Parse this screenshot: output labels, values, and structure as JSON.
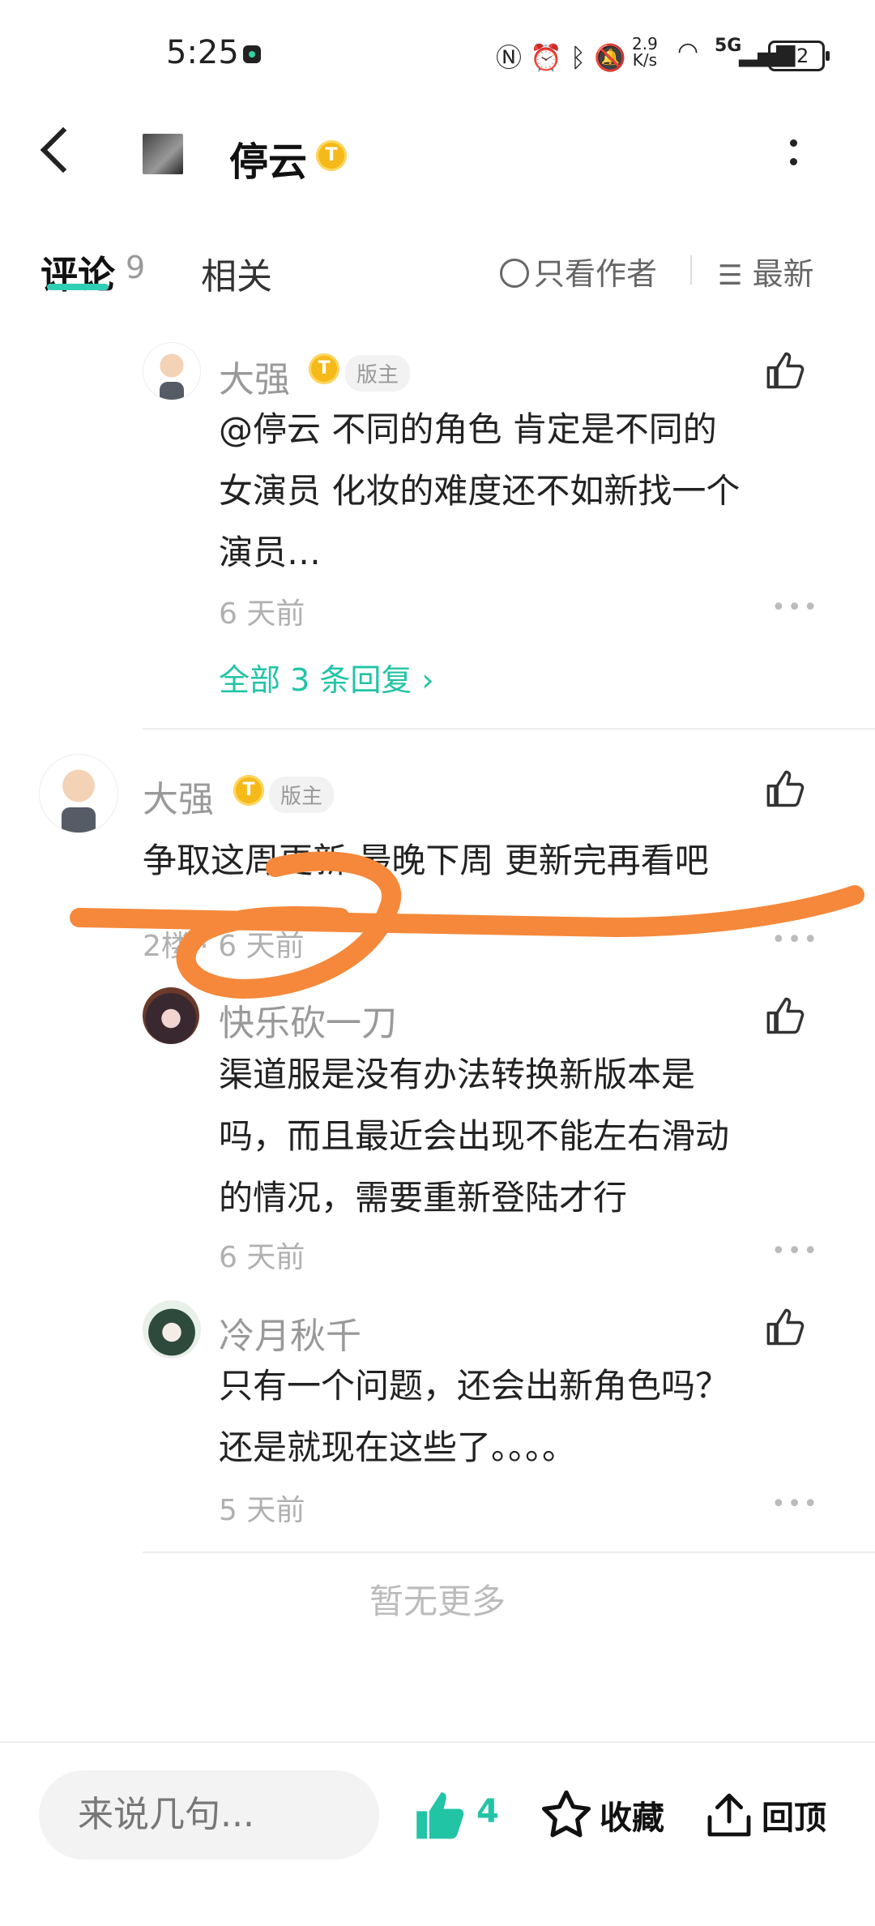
{
  "status_bar": {
    "time": "5:25",
    "net_speed_value": "2.9",
    "net_speed_unit": "K/s",
    "network": "5G",
    "battery": "92"
  },
  "header": {
    "title": "停云",
    "level_badge": "T"
  },
  "tabs": {
    "comments_label": "评论",
    "comments_count": "9",
    "related_label": "相关",
    "author_only_label": "只看作者",
    "sort_label": "最新"
  },
  "comments": [
    {
      "user": "大强",
      "level": "T",
      "tag": "版主",
      "text_lines": [
        "@停云  不同的角色 肯定是不同的",
        "女演员 化妆的难度还不如新找一个",
        "演员…"
      ],
      "time": "6 天前",
      "replies_link": "全部 3 条回复 ›"
    },
    {
      "user": "大强",
      "level": "T",
      "tag": "版主",
      "text_lines": [
        "争取这周更新 最晚下周 更新完再看吧"
      ],
      "floor_time": "2楼 · 6 天前"
    },
    {
      "user": "快乐砍一刀",
      "text_lines": [
        "渠道服是没有办法转换新版本是",
        "吗，而且最近会出现不能左右滑动",
        "的情况，需要重新登陆才行"
      ],
      "time": "6 天前"
    },
    {
      "user": "冷月秋千",
      "text_lines": [
        "只有一个问题，还会出新角色吗？",
        "还是就现在这些了。。。。"
      ],
      "time": "5 天前"
    }
  ],
  "footer_text": "暂无更多",
  "bottom_bar": {
    "input_placeholder": "来说几句...",
    "like_count": "4",
    "favorite_label": "收藏",
    "top_label": "回顶"
  },
  "colors": {
    "accent": "#22c4a6",
    "badge": "#f5b919",
    "annotation": "#f5883a"
  }
}
